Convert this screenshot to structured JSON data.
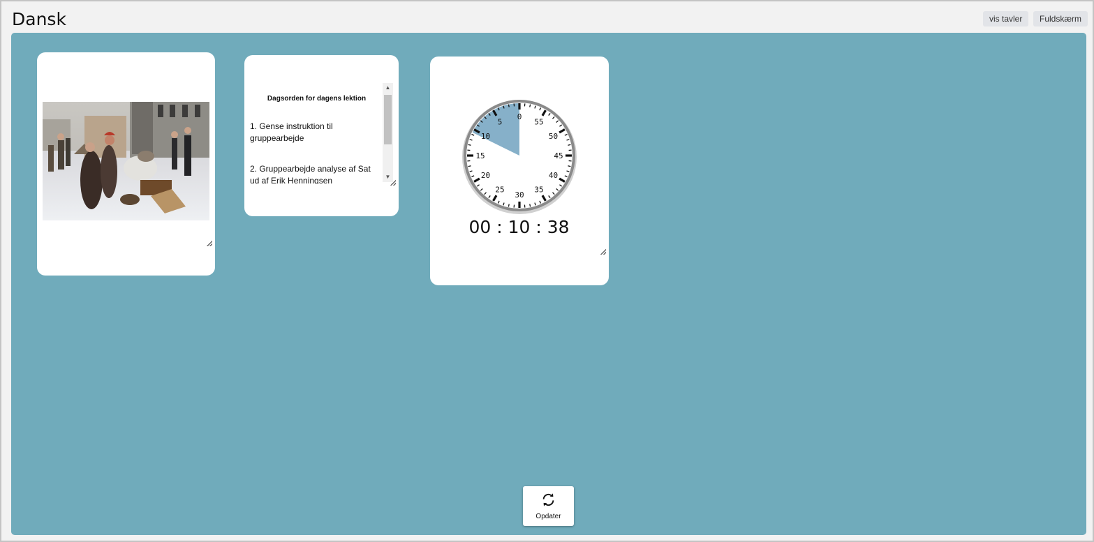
{
  "header": {
    "title": "Dansk",
    "buttons": {
      "show_boards": "vis tavler",
      "fullscreen": "Fuldskærm"
    }
  },
  "agenda": {
    "title": "Dagsorden for dagens lektion",
    "items": [
      "1. Gense instruktion til gruppearbejde",
      "2. Gruppearbejde analyse af Sat ud af Erik Henningsen"
    ]
  },
  "timer": {
    "display": "00 : 10 : 38",
    "dial_labels": [
      "0",
      "5",
      "10",
      "15",
      "20",
      "25",
      "30",
      "35",
      "40",
      "45",
      "50",
      "55"
    ],
    "elapsed_minutes": 10.63,
    "wedge_color": "#86b0c9"
  },
  "footer": {
    "refresh_label": "Opdater",
    "refresh_icon": "refresh-icon"
  },
  "colors": {
    "board": "#70abbb",
    "card": "#ffffff"
  }
}
